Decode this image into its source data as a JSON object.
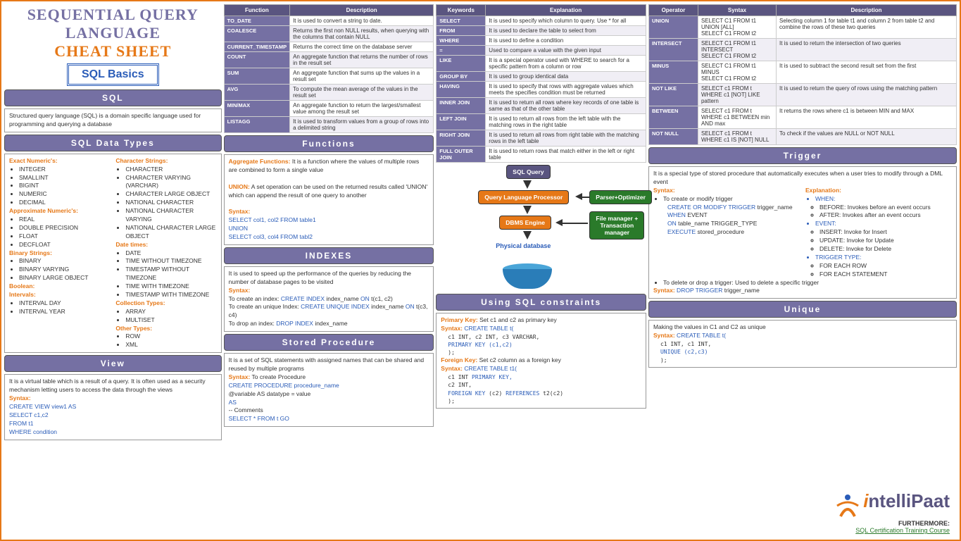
{
  "title": {
    "line1": "SEQUENTIAL QUERY",
    "line2": "LANGUAGE",
    "cheat": "CHEAT SHEET",
    "basics": "SQL Basics"
  },
  "sql": {
    "header": "SQL",
    "text": "Structured query language (SQL) is a domain specific language used for programming and querying a database"
  },
  "datatypes": {
    "header": "SQL Data Types",
    "exact_label": "Exact Numeric's:",
    "exact": [
      "INTEGER",
      "SMALLINT",
      "BIGINT",
      "NUMERIC",
      "DECIMAL"
    ],
    "approx_label": "Approximate Numeric's:",
    "approx": [
      "REAL",
      "DOUBLE PRECISION",
      "FLOAT",
      "DECFLOAT"
    ],
    "binary_label": "Binary Strings:",
    "binary": [
      "BINARY",
      "BINARY VARYING",
      "BINARY LARGE OBJECT"
    ],
    "boolean_label": "Boolean:",
    "intervals_label": "Intervals:",
    "intervals": [
      "INTERVAL DAY",
      "INTERVAL YEAR"
    ],
    "char_label": "Character Strings:",
    "char": [
      "CHARACTER",
      "CHARACTER VARYING (VARCHAR)",
      "CHARACTER LARGE OBJECT",
      "NATIONAL CHARACTER",
      "NATIONAL CHARACTER VARYING",
      "NATIONAL CHARACTER LARGE OBJECT"
    ],
    "date_label": "Date times:",
    "date": [
      "DATE",
      "TIME WITHOUT TIMEZONE",
      "TIMESTAMP WITHOUT TIMEZONE",
      "TIME WITH TIMEZONE",
      "TIMESTAMP WITH TIMEZONE"
    ],
    "coll_label": "Collection Types:",
    "coll": [
      "ARRAY",
      "MULTISET"
    ],
    "other_label": "Other Types:",
    "other": [
      "ROW",
      "XML"
    ]
  },
  "view": {
    "header": "View",
    "text": "It is a virtual table which is a result of a query. It is often used as a security mechanism letting users to access the data through the views",
    "syntax_label": "Syntax:",
    "code": [
      "CREATE VIEW view1 AS",
      "SELECT c1,c2",
      "FROM t1",
      "WHERE condition"
    ]
  },
  "func_table": {
    "h1": "Function",
    "h2": "Description",
    "rows": [
      [
        "TO_DATE",
        "It is used to convert a string to date."
      ],
      [
        "COALESCE",
        "Returns the first non NULL results, when querying with the columns that contain NULL"
      ],
      [
        "CURRENT_TIMESTAMP",
        "Returns the correct time on the database server"
      ],
      [
        "COUNT",
        "An aggregate function that returns the number of rows in the result set"
      ],
      [
        "SUM",
        "An aggregate function that sums up the values in a result set"
      ],
      [
        "AVG",
        "To compute the mean average of the values in the result set"
      ],
      [
        "MIN/MAX",
        "An aggregate function to return the largest/smallest value among the result set"
      ],
      [
        "LISTAGG",
        "It is used to transform values from a group of rows into a delimited string"
      ]
    ]
  },
  "functions": {
    "header": "Functions",
    "agg_label": "Aggregate Functions:",
    "agg": " It is a function where the values of multiple rows are combined to form a single value",
    "union_label": "UNION:",
    "union": " A set operation can be used on the returned results called 'UNION' which can append the result of one query to another",
    "syntax_label": "Syntax:",
    "code": [
      "SELECT col1, col2 FROM table1",
      "UNION",
      "SELECT col3, col4 FROM tabl2"
    ]
  },
  "indexes": {
    "header": "INDEXES",
    "text": "It is used to speed up the performance of the queries by reducing the number of database pages to be visited",
    "syntax_label": "Syntax:",
    "l1a": "To create an index: ",
    "l1b": "CREATE INDEX",
    "l1c": " index_name ",
    "l1d": "ON",
    "l1e": " t(c1, c2)",
    "l2a": "To create an unique Index: ",
    "l2b": "CREATE UNIQUE INDEX",
    "l2c": " index_name ",
    "l2d": "ON",
    "l2e": " t(c3, c4)",
    "l3a": "To drop an index: ",
    "l3b": "DROP INDEX",
    "l3c": " index_name"
  },
  "stored": {
    "header": "Stored Procedure",
    "text": "It is a set of SQL statements with assigned names that can be shared and reused by multiple programs",
    "syntax_label": "Syntax:",
    "syntax_text": " To create Procedure",
    "code": [
      "CREATE PROCEDURE procedure_name",
      "  @variable AS datatype = value",
      "AS",
      "  -- Comments",
      "SELECT * FROM t GO"
    ]
  },
  "keywords": {
    "h1": "Keywords",
    "h2": "Explanation",
    "rows": [
      [
        "SELECT",
        "It is used to specify which column to query. Use * for all"
      ],
      [
        "FROM",
        "It is used to declare the table to select from"
      ],
      [
        "WHERE",
        "It is used to define a condition"
      ],
      [
        "=",
        "Used to compare a value with the given input"
      ],
      [
        "LIKE",
        "It is a special operator used with WHERE to search for a specific pattern from a column or row"
      ],
      [
        "GROUP BY",
        "It is used to group identical data"
      ],
      [
        "HAVING",
        "It is used to specify that rows with aggregate values which meets the specifies condition must be returned"
      ],
      [
        "INNER JOIN",
        "It is used to return all rows where key records of one table is same as that of the other table"
      ],
      [
        "LEFT JOIN",
        "It is used to return all rows from the left table with the matching rows in the right table"
      ],
      [
        "RIGHT JOIN",
        "It is used to return all rows from right table with the matching rows in the left table"
      ],
      [
        "FULL OUTER JOIN",
        "It is used to return rows that match either in the left or right table"
      ]
    ]
  },
  "diagram": {
    "query": "SQL Query",
    "proc": "Query Language Processor",
    "parser": "Parser+Optimizer",
    "engine": "DBMS Engine",
    "mgr": "File manager + Transaction manager",
    "db": "Physical database"
  },
  "constraints": {
    "header": "Using SQL constraints",
    "pk_label": "Primary Key:",
    "pk": " Set c1 and c2 as primary key",
    "syntax_label": "Syntax:",
    "ct": " CREATE TABLE t(",
    "pk_code": [
      "    c1 INT, c2 INT, c3 VARCHAR,",
      "    PRIMARY KEY (c1,c2)",
      "    );"
    ],
    "fk_label": "Foreign Key:",
    "fk": " Set c2 column as a foreign key",
    "ct2": " CREATE TABLE t1(",
    "fk_code1": "    c1 INT ",
    "fk_code1b": "PRIMARY KEY,",
    "fk_code2": "    c2 INT,",
    "fk_code3a": "    FOREIGN KEY ",
    "fk_code3b": "(c2) ",
    "fk_code3c": "REFERENCES ",
    "fk_code3d": "t2(c2)",
    "fk_code4": "    );"
  },
  "operators": {
    "h1": "Operator",
    "h2": "Syntax",
    "h3": "Description",
    "rows": [
      [
        "UNION",
        "SELECT C1 FROM t1\nUNION [ALL]\nSELECT C1 FROM t2",
        "Selecting column 1 for table t1 and column 2 from table t2 and combine the rows of these two queries"
      ],
      [
        "INTERSECT",
        "SELECT C1 FROM t1\nINTERSECT\nSELECT C1 FROM t2",
        "It is used to return the intersection of two queries"
      ],
      [
        "MINUS",
        "SELECT C1 FROM t1\nMINUS\nSELECT C1 FROM t2",
        "It is used to subtract the second result set from the first"
      ],
      [
        "NOT LIKE",
        "SELECT c1 FROM t\nWHERE c1 [NOT] LIKE pattern",
        "It is used to return the query of rows using the matching pattern"
      ],
      [
        "BETWEEN",
        "SELECT c1 FROM t\nWHERE c1 BETWEEN min AND max",
        "It returns the rows where c1 is between MIN and MAX"
      ],
      [
        "NOT NULL",
        "SELECT c1 FROM t\nWHERE c1 IS [NOT] NULL",
        "To check if the values are NULL or NOT NULL"
      ]
    ]
  },
  "trigger": {
    "header": "Trigger",
    "text": "It is a special type of stored procedure that automatically executes when a user tries to modify through a DML event",
    "syntax_label": "Syntax:",
    "create": "To create or modify trigger",
    "code1": "CREATE OR MODIFY TRIGGER",
    "code1b": " trigger_name",
    "code2": "WHEN",
    "code2b": " EVENT",
    "code3": "ON",
    "code3b": " table_name TRIGGER_TYPE",
    "code4": "EXECUTE",
    "code4b": " stored_procedure",
    "exp_label": "Explanation:",
    "when_label": "WHEN:",
    "when": [
      "BEFORE: Invokes before an event occurs",
      "AFTER: Invokes after an event occurs"
    ],
    "event_label": "EVENT:",
    "event": [
      "INSERT: Invoke for Insert",
      "UPDATE: Invoke for Update",
      "DELETE: Invoke for Delete"
    ],
    "tt_label": "TRIGGER TYPE:",
    "tt": [
      "FOR EACH ROW",
      "FOR EACH STATEMENT"
    ],
    "delete": "To delete or drop a trigger: Used to delete a specific trigger",
    "drop_label": "Syntax:",
    "drop": " DROP TRIGGER ",
    "drop2": "trigger_name"
  },
  "unique": {
    "header": "Unique",
    "text": "Making the values in C1 and C2 as unique",
    "syntax_label": "Syntax:",
    "ct": " CREATE TABLE t(",
    "code": [
      "    c1 INT, c1 INT,",
      "    UNIQUE (c2,c3)",
      "    );"
    ]
  },
  "footer": {
    "logo1": "i",
    "logo2": "ntelliPaat",
    "further": "FURTHERMORE:",
    "link": "SQL Certification Training Course"
  }
}
